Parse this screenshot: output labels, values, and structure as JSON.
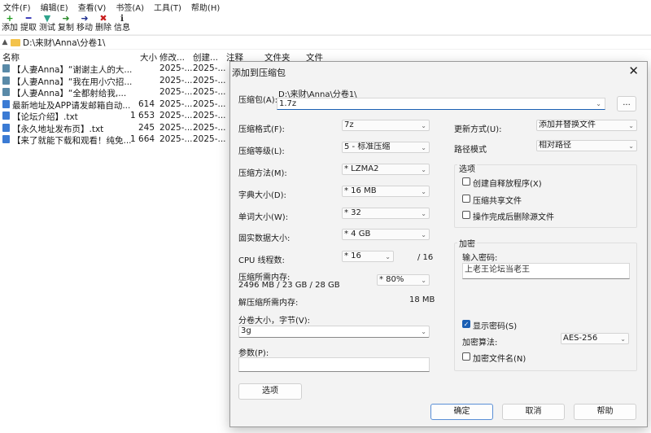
{
  "menu": [
    "文件(F)",
    "编辑(E)",
    "查看(V)",
    "书签(A)",
    "工具(T)",
    "帮助(H)"
  ],
  "toolbar": [
    {
      "label": "添加",
      "icon": "+",
      "color": "#1c9b1c",
      "name": "add"
    },
    {
      "label": "提取",
      "icon": "━",
      "color": "#2d2db3",
      "name": "extract"
    },
    {
      "label": "测试",
      "icon": "▼",
      "color": "#2fa38c",
      "name": "test"
    },
    {
      "label": "复制",
      "icon": "➜",
      "color": "#2a8a2a",
      "name": "copy"
    },
    {
      "label": "移动",
      "icon": "➜",
      "color": "#1f2f8f",
      "name": "move"
    },
    {
      "label": "删除",
      "icon": "✖",
      "color": "#c81e1e",
      "name": "delete"
    },
    {
      "label": "信息",
      "icon": "ℹ",
      "color": "#333333",
      "name": "info"
    }
  ],
  "path": "D:\\来财\\Anna\\分卷1\\",
  "columns": [
    "名称",
    "大小",
    "修改...",
    "创建...",
    "注释",
    "文件夹",
    "文件"
  ],
  "files": [
    {
      "name": "【人妻Anna】“谢谢主人的大...",
      "size": "",
      "mod": "2025-...",
      "cre": "2025-...",
      "type": "folder"
    },
    {
      "name": "【人妻Anna】“我在用小穴招...",
      "size": "",
      "mod": "2025-...",
      "cre": "2025-...",
      "type": "folder"
    },
    {
      "name": "【人妻Anna】“全都射给我,...",
      "size": "",
      "mod": "2025-...",
      "cre": "2025-...",
      "type": "folder"
    },
    {
      "name": "最新地址及APP请发邮箱自动...",
      "size": "614",
      "mod": "2025-...",
      "cre": "2025-...",
      "type": "file"
    },
    {
      "name": "【论坛介绍】.txt",
      "size": "1 653",
      "mod": "2025-...",
      "cre": "2025-...",
      "type": "file"
    },
    {
      "name": "【永久地址发布页】.txt",
      "size": "245",
      "mod": "2025-...",
      "cre": "2025-...",
      "type": "file"
    },
    {
      "name": "【来了就能下载和观看！纯免...",
      "size": "1 664",
      "mod": "2025-...",
      "cre": "2025-...",
      "type": "file"
    }
  ],
  "dialog": {
    "title": "添加到压缩包",
    "close": "✕",
    "archive_label": "压缩包(A):",
    "archive_dir": "D:\\来财\\Anna\\分卷1\\",
    "archive_name": "1.7z",
    "browse": "...",
    "format_label": "压缩格式(F):",
    "format": "7z",
    "level_label": "压缩等级(L):",
    "level": "5 - 标准压缩",
    "method_label": "压缩方法(M):",
    "method": "*  LZMA2",
    "dict_label": "字典大小(D):",
    "dict": "*  16 MB",
    "word_label": "单词大小(W):",
    "word": "*  32",
    "solid_label": "固实数据大小:",
    "solid": "*  4 GB",
    "cpu_label": "CPU 线程数:",
    "cpu": "*  16",
    "cpu_total": "/ 16",
    "mem_comp_label": "压缩所需内存:",
    "mem_comp": "2496 MB / 23 GB / 28 GB",
    "mem_pct": "* 80%",
    "mem_decomp_label": "解压缩所需内存:",
    "mem_decomp": "18 MB",
    "split_label": "分卷大小，字节(V):",
    "split": "3g",
    "params_label": "参数(P):",
    "params": "",
    "options_button": "选项",
    "update_label": "更新方式(U):",
    "update": "添加并替换文件",
    "pathmode_label": "路径模式",
    "pathmode": "相对路径",
    "options_group": "选项",
    "opt_sfx": "创建自释放程序(X)",
    "opt_shared": "压缩共享文件",
    "opt_delete": "操作完成后删除源文件",
    "enc_group": "加密",
    "pwd_label": "输入密码:",
    "pwd": "上老王论坛当老王",
    "show_pwd": "显示密码(S)",
    "enc_method_label": "加密算法:",
    "enc_method": "AES-256",
    "enc_names": "加密文件名(N)",
    "ok": "确定",
    "cancel": "取消",
    "help": "帮助"
  }
}
